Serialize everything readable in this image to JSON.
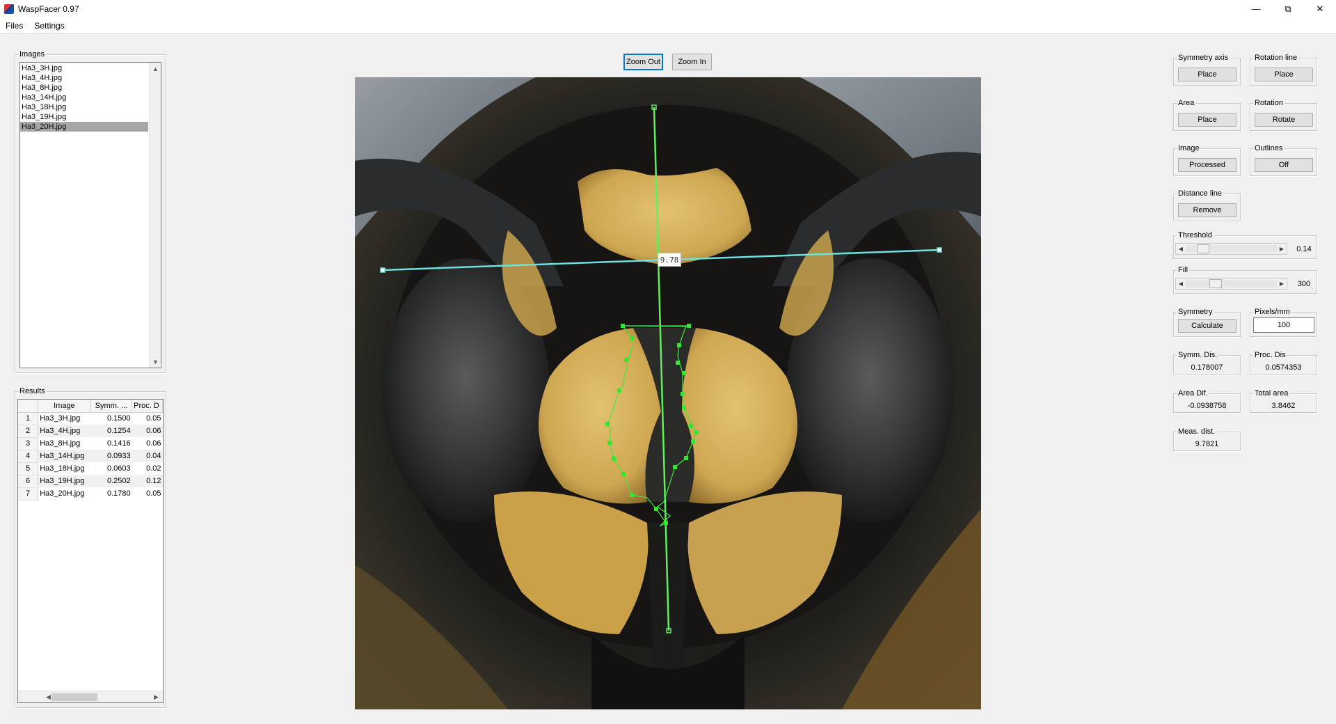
{
  "window": {
    "title": "WaspFacer 0.97"
  },
  "menu": {
    "files": "Files",
    "settings": "Settings"
  },
  "images_panel": {
    "title": "Images",
    "items": [
      "Ha3_3H.jpg",
      "Ha3_4H.jpg",
      "Ha3_8H.jpg",
      "Ha3_14H.jpg",
      "Ha3_18H.jpg",
      "Ha3_19H.jpg",
      "Ha3_20H.jpg"
    ],
    "selected_index": 6
  },
  "results_panel": {
    "title": "Results",
    "columns": [
      "Image",
      "Symm. ...",
      "Proc. D"
    ],
    "rows": [
      [
        "1",
        "Ha3_3H.jpg",
        "0.1500",
        "0.05"
      ],
      [
        "2",
        "Ha3_4H.jpg",
        "0.1254",
        "0.06"
      ],
      [
        "3",
        "Ha3_8H.jpg",
        "0.1416",
        "0.06"
      ],
      [
        "4",
        "Ha3_14H.jpg",
        "0.0933",
        "0.04"
      ],
      [
        "5",
        "Ha3_18H.jpg",
        "0.0603",
        "0.02"
      ],
      [
        "6",
        "Ha3_19H.jpg",
        "0.2502",
        "0.12"
      ],
      [
        "7",
        "Ha3_20H.jpg",
        "0.1780",
        "0.05"
      ]
    ]
  },
  "zoom": {
    "zoom_out": "Zoom Out",
    "zoom_in": "Zoom In"
  },
  "image_view": {
    "distance_label": "9.78"
  },
  "controls": {
    "symmetry_axis": {
      "title": "Symmetry axis",
      "button": "Place"
    },
    "rotation_line": {
      "title": "Rotation line",
      "button": "Place"
    },
    "area": {
      "title": "Area",
      "button": "Place"
    },
    "rotation": {
      "title": "Rotation",
      "button": "Rotate"
    },
    "image": {
      "title": "Image",
      "button": "Processed"
    },
    "outlines": {
      "title": "Outlines",
      "button": "Off"
    },
    "distance_line": {
      "title": "Distance line",
      "button": "Remove"
    },
    "threshold": {
      "title": "Threshold",
      "value": "0.14",
      "level": 0.14
    },
    "fill": {
      "title": "Fill",
      "value": "300",
      "level": 0.3
    },
    "symmetry": {
      "title": "Symmetry",
      "button": "Calculate"
    },
    "pixels_mm": {
      "title": "Pixels/mm",
      "value": "100"
    },
    "symm_dis": {
      "title": "Symm. Dis.",
      "value": "0.178007"
    },
    "proc_dis": {
      "title": "Proc. Dis",
      "value": "0.0574353"
    },
    "area_dif": {
      "title": "Area Dif.",
      "value": "-0.0938758"
    },
    "total_area": {
      "title": "Total area",
      "value": "3.8462"
    },
    "meas_dist": {
      "title": "Meas. dist.",
      "value": "9.7821"
    }
  }
}
